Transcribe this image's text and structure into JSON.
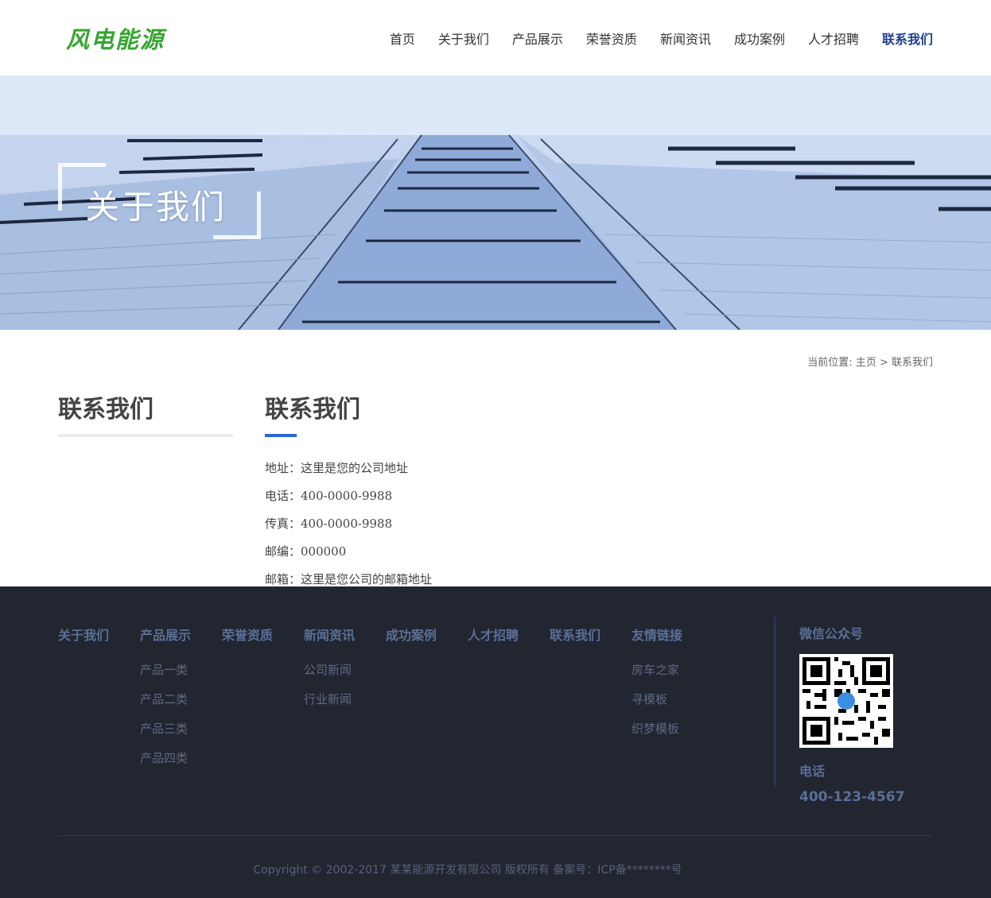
{
  "header": {
    "logo": "风电能源",
    "nav": [
      "首页",
      "关于我们",
      "产品展示",
      "荣誉资质",
      "新闻资讯",
      "成功案例",
      "人才招聘",
      "联系我们"
    ],
    "active_index": 7
  },
  "banner": {
    "title": "关于我们"
  },
  "breadcrumb": {
    "prefix": "当前位置:",
    "home": "主页",
    "sep": ">",
    "current": "联系我们"
  },
  "sidebar": {
    "title": "联系我们"
  },
  "main": {
    "title": "联系我们",
    "lines": [
      "地址：这里是您的公司地址",
      "电话：400-0000-9988",
      "传真：400-0000-9988",
      "邮编：000000",
      "邮箱：这里是您公司的邮箱地址"
    ]
  },
  "footer": {
    "columns": [
      {
        "title": "关于我们",
        "links": []
      },
      {
        "title": "产品展示",
        "links": [
          "产品一类",
          "产品二类",
          "产品三类",
          "产品四类"
        ]
      },
      {
        "title": "荣誉资质",
        "links": []
      },
      {
        "title": "新闻资讯",
        "links": [
          "公司新闻",
          "行业新闻"
        ]
      },
      {
        "title": "成功案例",
        "links": []
      },
      {
        "title": "人才招聘",
        "links": []
      },
      {
        "title": "联系我们",
        "links": []
      },
      {
        "title": "友情链接",
        "links": [
          "房车之家",
          "寻模板",
          "织梦模板"
        ]
      }
    ],
    "wechat_title": "微信公众号",
    "phone_label": "电话",
    "phone": "400-123-4567",
    "copyright": "Copyright © 2002-2017 某某能源开发有限公司 版权所有 备案号：ICP备********号"
  },
  "colors": {
    "logo": "#36a630",
    "nav_active": "#1f3f8f",
    "accent_bar": "#2a66d6",
    "footer_bg": "#222630"
  }
}
